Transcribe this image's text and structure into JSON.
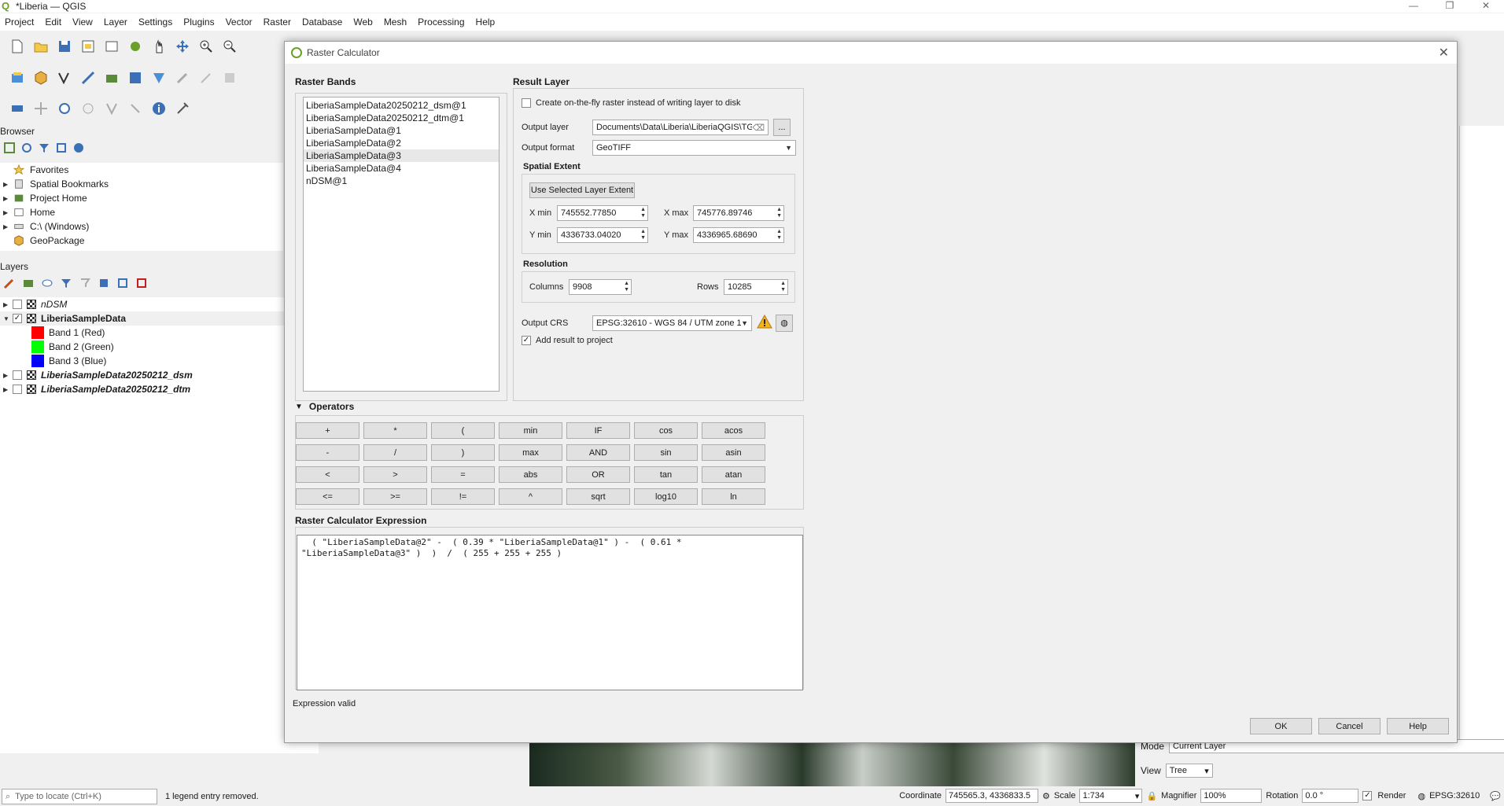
{
  "window": {
    "title": "*Liberia — QGIS",
    "controls": [
      "—",
      "❐",
      "✕"
    ]
  },
  "menu": [
    "Project",
    "Edit",
    "View",
    "Layer",
    "Settings",
    "Plugins",
    "Vector",
    "Raster",
    "Database",
    "Web",
    "Mesh",
    "Processing",
    "Help"
  ],
  "browser": {
    "title": "Browser",
    "items": [
      {
        "label": "Favorites",
        "icon": "star-icon"
      },
      {
        "label": "Spatial Bookmarks",
        "icon": "bookmark-icon"
      },
      {
        "label": "Project Home",
        "icon": "home-folder-icon"
      },
      {
        "label": "Home",
        "icon": "home-icon"
      },
      {
        "label": "C:\\ (Windows)",
        "icon": "drive-icon"
      },
      {
        "label": "GeoPackage",
        "icon": "geopackage-icon"
      }
    ]
  },
  "layers": {
    "title": "Layers",
    "items": [
      {
        "label": "nDSM",
        "checked": false,
        "style": "italic"
      },
      {
        "label": "LiberiaSampleData",
        "checked": true,
        "style": "bold"
      },
      {
        "label": "Band 1 (Red)",
        "color": "#ff0000"
      },
      {
        "label": "Band 2 (Green)",
        "color": "#00ff00"
      },
      {
        "label": "Band 3 (Blue)",
        "color": "#0000ff"
      },
      {
        "label": "LiberiaSampleData20250212_dsm",
        "checked": false,
        "style": "italic-bold"
      },
      {
        "label": "LiberiaSampleData20250212_dtm",
        "checked": false,
        "style": "italic-bold"
      }
    ]
  },
  "dialog": {
    "title": "Raster Calculator",
    "raster_bands_label": "Raster Bands",
    "raster_bands": [
      "LiberiaSampleData20250212_dsm@1",
      "LiberiaSampleData20250212_dtm@1",
      "LiberiaSampleData@1",
      "LiberiaSampleData@2",
      "LiberiaSampleData@3",
      "LiberiaSampleData@4",
      "nDSM@1"
    ],
    "selected_band_index": 4,
    "result_layer_label": "Result Layer",
    "on_the_fly_label": "Create on-the-fly raster instead of writing layer to disk",
    "output_layer_label": "Output layer",
    "output_layer_value": "Documents\\Data\\Liberia\\LiberiaQGIS\\TGI",
    "browse_label": "...",
    "output_format_label": "Output format",
    "output_format_value": "GeoTIFF",
    "spatial_extent_label": "Spatial Extent",
    "use_selected_extent_label": "Use Selected Layer Extent",
    "xmin_label": "X min",
    "xmin_value": "745552.77850",
    "xmax_label": "X max",
    "xmax_value": "745776.89746",
    "ymin_label": "Y min",
    "ymin_value": "4336733.04020",
    "ymax_label": "Y max",
    "ymax_value": "4336965.68690",
    "resolution_label": "Resolution",
    "columns_label": "Columns",
    "columns_value": "9908",
    "rows_label": "Rows",
    "rows_value": "10285",
    "output_crs_label": "Output CRS",
    "output_crs_value": "EPSG:32610 - WGS 84 / UTM zone 1",
    "add_result_label": "Add result to project",
    "operators_label": "Operators",
    "operators": [
      [
        "+",
        "*",
        "(",
        "min",
        "IF",
        "cos",
        "acos"
      ],
      [
        "-",
        "/",
        ")",
        "max",
        "AND",
        "sin",
        "asin"
      ],
      [
        "<",
        ">",
        "=",
        "abs",
        "OR",
        "tan",
        "atan"
      ],
      [
        "<=",
        ">=",
        "!=",
        "^",
        "sqrt",
        "log10",
        "ln"
      ]
    ],
    "expression_label": "Raster Calculator Expression",
    "expression": "  ( \"LiberiaSampleData@2\" -  ( 0.39 * \"LiberiaSampleData@1\" ) -  ( 0.61 *\n\"LiberiaSampleData@3\" )  )  /  ( 255 + 255 + 255 )",
    "expression_status": "Expression valid",
    "ok_label": "OK",
    "cancel_label": "Cancel",
    "help_label": "Help"
  },
  "bottom_panel": {
    "mode_label": "Mode",
    "mode_value": "Current Layer",
    "view_label": "View",
    "view_value": "Tree"
  },
  "status": {
    "locate_placeholder": "Type to locate (Ctrl+K)",
    "message": "1 legend entry removed.",
    "coordinate_label": "Coordinate",
    "coordinate_value": "745565.3, 4336833.5",
    "scale_label": "Scale",
    "scale_value": "1:734",
    "magnifier_label": "Magnifier",
    "magnifier_value": "100%",
    "rotation_label": "Rotation",
    "rotation_value": "0.0 °",
    "render_label": "Render",
    "crs_value": "EPSG:32610"
  }
}
